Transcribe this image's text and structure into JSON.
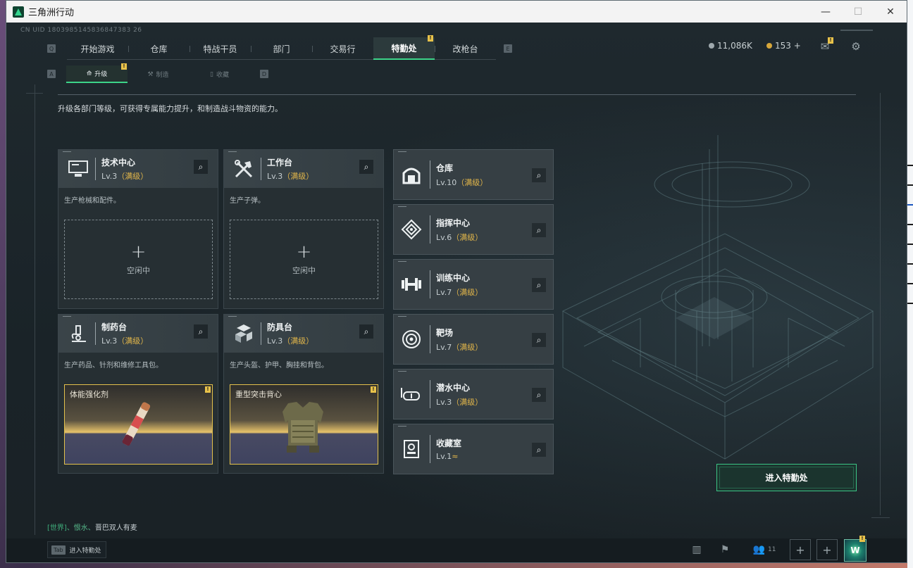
{
  "window": {
    "title": "三角洲行动",
    "controls": {
      "minimize": "—",
      "maximize": "☐",
      "close": "✕"
    }
  },
  "uid": "CN UID 1803985145836847383 26",
  "key_hints": {
    "main_left": "Q",
    "main_right": "E",
    "sub_left": "A",
    "sub_right": "D"
  },
  "main_tabs": [
    {
      "label": "开始游戏",
      "active": false
    },
    {
      "label": "仓库",
      "active": false
    },
    {
      "label": "特战干员",
      "active": false
    },
    {
      "label": "部门",
      "active": false
    },
    {
      "label": "交易行",
      "active": false
    },
    {
      "label": "特勤处",
      "active": true,
      "badge": "!"
    },
    {
      "label": "改枪台",
      "active": false
    }
  ],
  "currency": {
    "silver": "11,086K",
    "gold": "153 +",
    "colors": {
      "silver": "#9ea8ad",
      "gold": "#d7a73b"
    }
  },
  "header_icons": {
    "mail_badge": "!",
    "mail": "mail-icon",
    "settings": "gear-icon"
  },
  "sub_tabs": [
    {
      "label": "升级",
      "icon": "upgrade-icon",
      "active": true,
      "badge": "!"
    },
    {
      "label": "制造",
      "icon": "craft-icon",
      "active": false
    },
    {
      "label": "收藏",
      "icon": "collect-icon",
      "active": false
    }
  ],
  "description": "升级各部门等级，可获得专属能力提升，和制造战斗物资的能力。",
  "facilities": [
    {
      "name": "技术中心",
      "level": "Lv.3",
      "max": "（满级）",
      "desc": "生产枪械和配件。",
      "status": "空闲中",
      "icon": "computer-icon"
    },
    {
      "name": "工作台",
      "level": "Lv.3",
      "max": "（满级）",
      "desc": "生产子弹。",
      "status": "空闲中",
      "icon": "tools-icon"
    },
    {
      "name": "制药台",
      "level": "Lv.3",
      "max": "（满级）",
      "desc": "生产药品、针剂和维修工具包。",
      "product": "体能强化剂",
      "product_badge": "!",
      "icon": "microscope-icon"
    },
    {
      "name": "防具台",
      "level": "Lv.3",
      "max": "（满级）",
      "desc": "生产头盔、护甲、胸挂和背包。",
      "product": "重型突击背心",
      "product_badge": "!",
      "icon": "armor-icon"
    }
  ],
  "departments": [
    {
      "name": "仓库",
      "level": "Lv.10",
      "max": "（满级）",
      "icon": "warehouse-icon"
    },
    {
      "name": "指挥中心",
      "level": "Lv.6",
      "max": "（满级）",
      "icon": "command-icon"
    },
    {
      "name": "训练中心",
      "level": "Lv.7",
      "max": "（满级）",
      "icon": "dumbbell-icon"
    },
    {
      "name": "靶场",
      "level": "Lv.7",
      "max": "（满级）",
      "icon": "target-icon"
    },
    {
      "name": "潜水中心",
      "level": "Lv.3",
      "max": "（满级）",
      "icon": "diving-mask-icon"
    },
    {
      "name": "收藏室",
      "level": "Lv.1",
      "max": "",
      "icon": "collection-icon"
    }
  ],
  "enter_button": "进入特勤处",
  "chat": {
    "channel": "[世界]",
    "sender": "、恨水、",
    "message": "晋巴双人有麦"
  },
  "bottom": {
    "tab_key": "Tab",
    "tab_label": "进入特勤处",
    "friends_count": "11",
    "avatar_badge": "!",
    "avatar_initials": "W"
  },
  "colors": {
    "accent": "#3cd489",
    "max_level": "#e2b64a",
    "badge": "#e8c24a"
  }
}
